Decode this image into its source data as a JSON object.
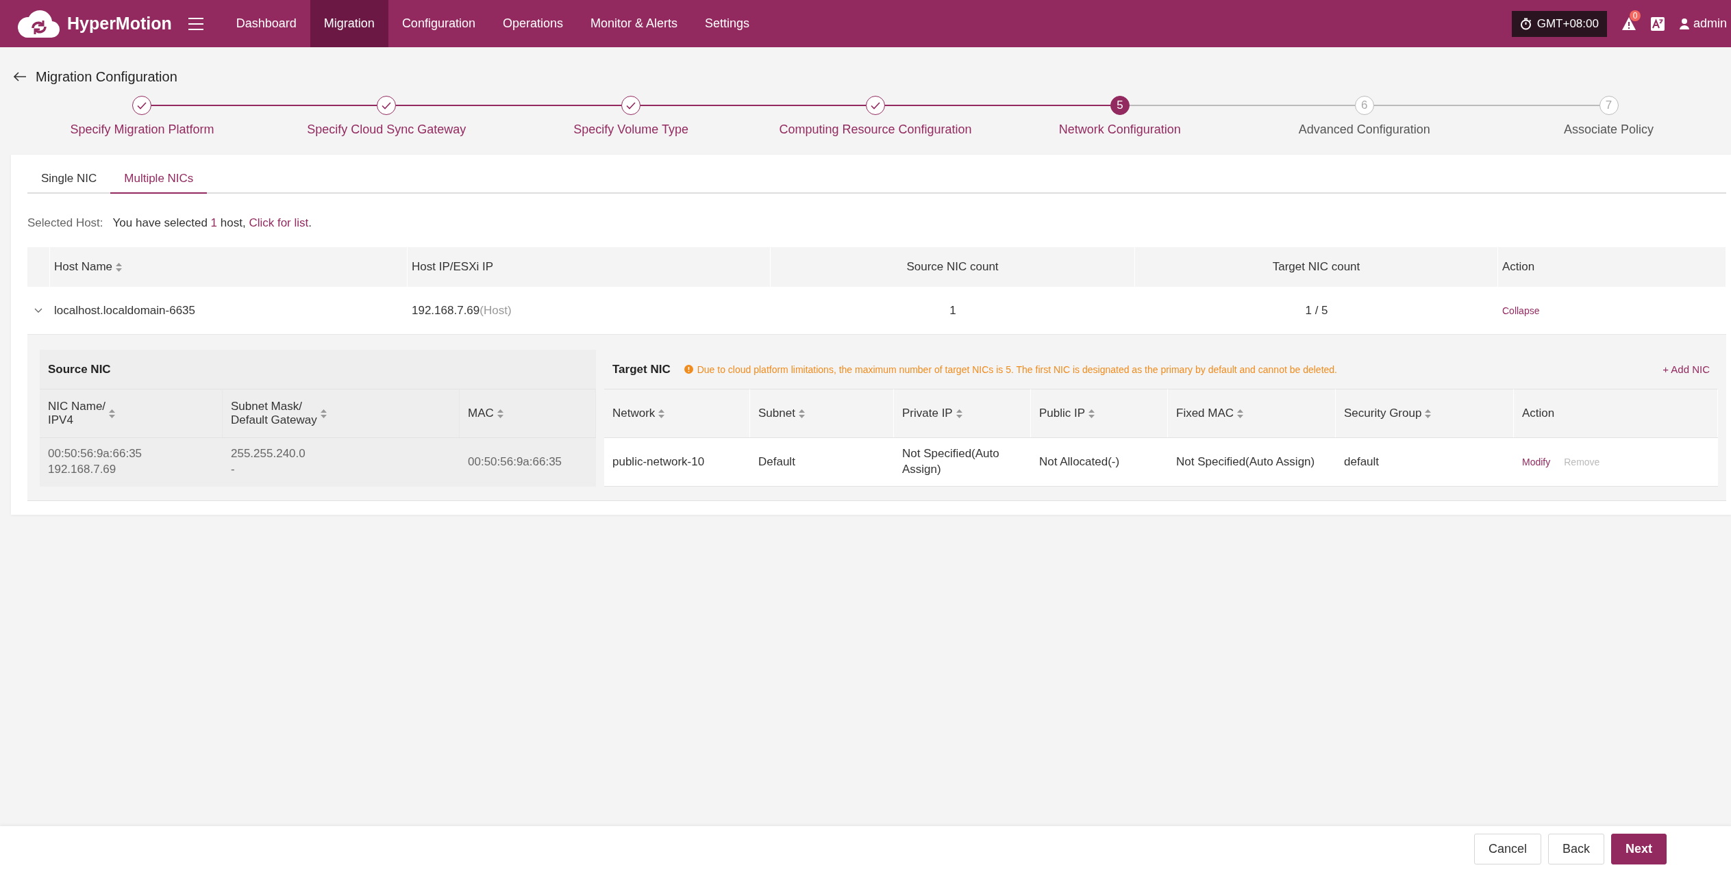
{
  "header": {
    "brand": "HyperMotion",
    "nav": [
      {
        "label": "Dashboard",
        "selected": false
      },
      {
        "label": "Migration",
        "selected": true
      },
      {
        "label": "Configuration",
        "selected": false
      },
      {
        "label": "Operations",
        "selected": false
      },
      {
        "label": "Monitor & Alerts",
        "selected": false
      },
      {
        "label": "Settings",
        "selected": false
      }
    ],
    "timezone": "GMT+08:00",
    "alert_count": "0",
    "user": "admin"
  },
  "page_title": "Migration Configuration",
  "steps": [
    {
      "label": "Specify Migration Platform",
      "completed": true,
      "selected": false
    },
    {
      "label": "Specify Cloud Sync Gateway",
      "completed": true,
      "selected": false
    },
    {
      "label": "Specify Volume Type",
      "completed": true,
      "selected": false
    },
    {
      "label": "Computing Resource Configuration",
      "completed": true,
      "selected": false
    },
    {
      "label": "Network Configuration",
      "number": "5",
      "completed": false,
      "selected": true
    },
    {
      "label": "Advanced Configuration",
      "number": "6",
      "completed": false,
      "selected": false
    },
    {
      "label": "Associate Policy",
      "number": "7",
      "completed": false,
      "selected": false
    }
  ],
  "tabs": [
    {
      "label": "Single NIC",
      "selected": false
    },
    {
      "label": "Multiple NICs",
      "selected": true
    }
  ],
  "selected_host": {
    "label": "Selected Host:",
    "text_before": "You have selected ",
    "count": "1",
    "text_after": " host, ",
    "link": "Click for list",
    "text_end": "."
  },
  "hosts_table": {
    "columns": [
      {
        "label": "Host Name",
        "sortable": true
      },
      {
        "label": "Host IP/ESXi IP",
        "sortable": false
      },
      {
        "label": "Source NIC count",
        "sortable": false
      },
      {
        "label": "Target NIC count",
        "sortable": false
      },
      {
        "label": "Action",
        "sortable": false
      }
    ],
    "rows": [
      {
        "host_name": "localhost.localdomain-6635",
        "ip": "192.168.7.69",
        "ip_note": "(Host)",
        "source_nic_count": "1",
        "target_nic_count": "1 / 5",
        "action": "Collapse",
        "expanded": true
      }
    ]
  },
  "source_nic": {
    "title": "Source NIC",
    "columns": [
      {
        "lines": [
          "NIC Name/",
          "IPV4"
        ],
        "sortable": true
      },
      {
        "lines": [
          "Subnet Mask/",
          "Default Gateway"
        ],
        "sortable": true
      },
      {
        "lines": [
          "MAC"
        ],
        "sortable": true
      }
    ],
    "rows": [
      {
        "nic_name": "00:50:56:9a:66:35",
        "ipv4": "192.168.7.69",
        "subnet_mask": "255.255.240.0",
        "gateway": "-",
        "mac": "00:50:56:9a:66:35"
      }
    ]
  },
  "target_nic": {
    "title": "Target NIC",
    "notice": "Due to cloud platform limitations, the maximum number of target NICs is 5. The first NIC is designated as the primary by default and cannot be deleted.",
    "add_button": "+ Add NIC",
    "columns": [
      {
        "label": "Network",
        "sortable": true
      },
      {
        "label": "Subnet",
        "sortable": true
      },
      {
        "label": "Private IP",
        "sortable": true
      },
      {
        "label": "Public IP",
        "sortable": true
      },
      {
        "label": "Fixed MAC",
        "sortable": true
      },
      {
        "label": "Security Group",
        "sortable": true
      },
      {
        "label": "Action",
        "sortable": false
      }
    ],
    "rows": [
      {
        "network": "public-network-10",
        "subnet": "Default",
        "private_ip": "Not Specified(Auto Assign)",
        "public_ip": "Not Allocated(-)",
        "fixed_mac": "Not Specified(Auto Assign)",
        "security_group": "default",
        "actions": [
          {
            "label": "Modify",
            "disabled": false
          },
          {
            "label": "Remove",
            "disabled": true
          }
        ]
      }
    ]
  },
  "footer": {
    "buttons": [
      {
        "label": "Cancel",
        "kind": "default"
      },
      {
        "label": "Back",
        "kind": "default"
      },
      {
        "label": "Next",
        "kind": "primary"
      }
    ]
  }
}
